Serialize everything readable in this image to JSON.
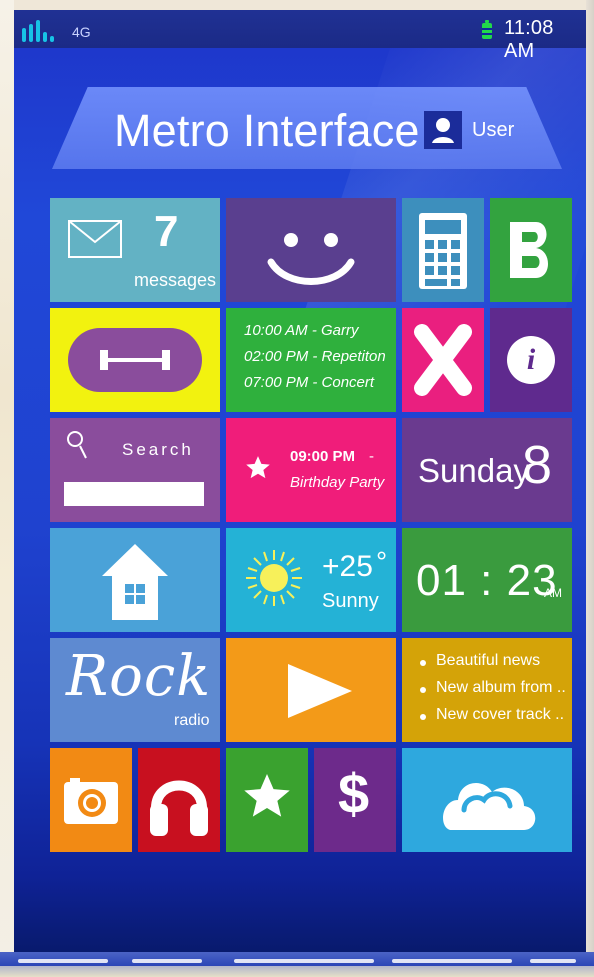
{
  "status": {
    "network": "4G",
    "time": "11:08 AM"
  },
  "header": {
    "title": "Metro Interface",
    "user_label": "User"
  },
  "tiles": {
    "messages": {
      "count": "7",
      "label": "messages"
    },
    "contacts": {},
    "schedule": {
      "items": [
        "10:00 AM - Garry",
        "02:00 PM - Repetiton",
        "07:00 PM - Concert"
      ]
    },
    "search": {
      "label": "Search"
    },
    "event": {
      "time": "09:00 PM",
      "separator": "-",
      "title": "Birthday Party"
    },
    "date": {
      "day": "Sunday",
      "number": "8"
    },
    "weather": {
      "temp": "+25",
      "unit": "°",
      "condition": "Sunny"
    },
    "clock": {
      "time": "01 : 23",
      "ampm": "AM"
    },
    "radio": {
      "genre": "Rock",
      "label": "radio"
    },
    "news": {
      "items": [
        "Beautiful news",
        "New album from ..",
        "New cover track .."
      ]
    }
  },
  "icons": {
    "mail": "mail-icon",
    "smile": "smiley-icon",
    "calculator": "calculator-icon",
    "bold": "bold-b-icon",
    "dumbbell": "dumbbell-icon",
    "close": "x-icon",
    "info": "info-icon",
    "search": "search-icon",
    "star": "star-icon",
    "home": "home-icon",
    "sun": "sun-icon",
    "play": "play-icon",
    "camera": "camera-icon",
    "headphones": "headphones-icon",
    "dollar": "dollar-icon",
    "cloud": "cloud-icon"
  },
  "colors": {
    "teal": "#63b2c4",
    "purple": "#5a3f8f",
    "green": "#33a33f",
    "yellow": "#f2f20f",
    "pink": "#ea1f7f",
    "violet": "#5f2a8e",
    "search_purple": "#8a4d9c",
    "event_pink": "#f01d7a",
    "date_purple": "#6a3a8f",
    "home_blue": "#4aa2d8",
    "weather_blue": "#24b2d6",
    "clock_green": "#3a9b3e",
    "radio_blue": "#5e8ad1",
    "play_orange": "#f39a18",
    "news_gold": "#d4a308",
    "camera_orange": "#f28a14",
    "headphone_red": "#c8101f",
    "star_green": "#3aa22f",
    "dollar_purple": "#6d2a8b",
    "cloud_blue": "#2ea8de"
  }
}
